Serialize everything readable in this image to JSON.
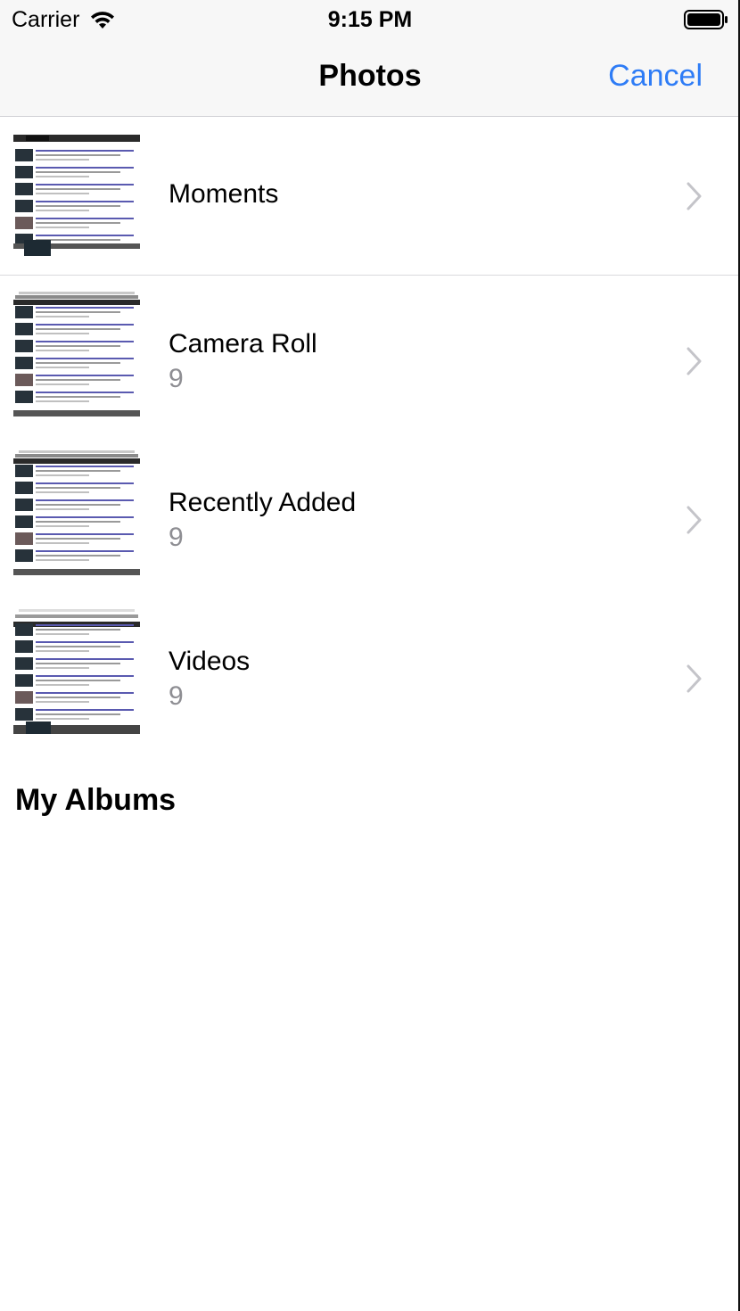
{
  "status_bar": {
    "carrier": "Carrier",
    "time": "9:15 PM"
  },
  "nav": {
    "title": "Photos",
    "cancel_label": "Cancel"
  },
  "albums": [
    {
      "title": "Moments",
      "count": ""
    },
    {
      "title": "Camera Roll",
      "count": "9"
    },
    {
      "title": "Recently Added",
      "count": "9"
    },
    {
      "title": "Videos",
      "count": "9"
    }
  ],
  "sections": {
    "my_albums": "My Albums"
  },
  "colors": {
    "accent": "#2e7cf6",
    "secondary_text": "#8e8e93",
    "bar_background": "#f7f7f7",
    "separator": "#d9d9dd"
  },
  "icons": {
    "wifi": "wifi-icon",
    "battery": "battery-icon",
    "chevron": "chevron-right-icon"
  }
}
